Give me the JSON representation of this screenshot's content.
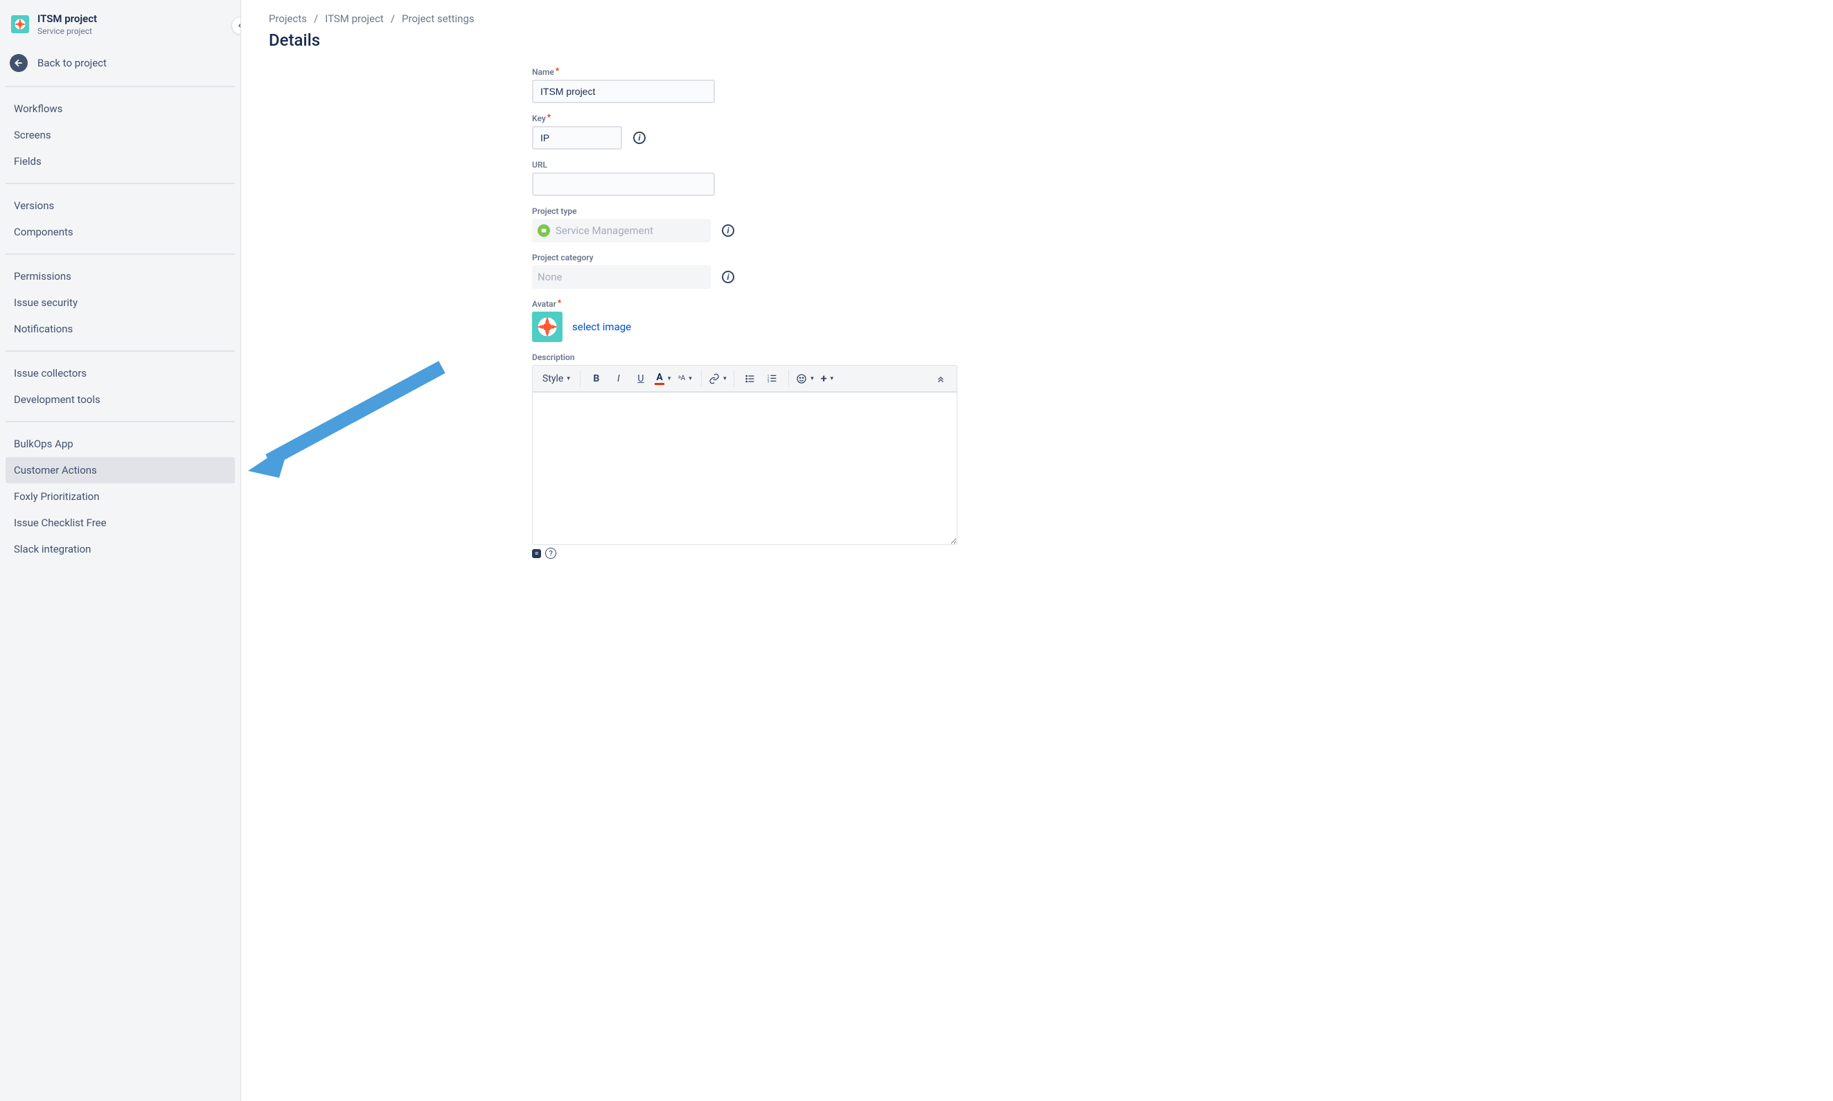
{
  "sidebar": {
    "project_title": "ITSM project",
    "project_subtitle": "Service project",
    "back_label": "Back to project",
    "groups": [
      {
        "items": [
          {
            "label": "Workflows",
            "selected": false
          },
          {
            "label": "Screens",
            "selected": false
          },
          {
            "label": "Fields",
            "selected": false
          }
        ]
      },
      {
        "items": [
          {
            "label": "Versions",
            "selected": false
          },
          {
            "label": "Components",
            "selected": false
          }
        ]
      },
      {
        "items": [
          {
            "label": "Permissions",
            "selected": false
          },
          {
            "label": "Issue security",
            "selected": false
          },
          {
            "label": "Notifications",
            "selected": false
          }
        ]
      },
      {
        "items": [
          {
            "label": "Issue collectors",
            "selected": false
          },
          {
            "label": "Development tools",
            "selected": false
          }
        ]
      },
      {
        "items": [
          {
            "label": "BulkOps App",
            "selected": false
          },
          {
            "label": "Customer Actions",
            "selected": true
          },
          {
            "label": "Foxly Prioritization",
            "selected": false
          },
          {
            "label": "Issue Checklist Free",
            "selected": false
          },
          {
            "label": "Slack integration",
            "selected": false
          }
        ]
      }
    ]
  },
  "breadcrumb": {
    "projects": "Projects",
    "project": "ITSM project",
    "settings": "Project settings"
  },
  "page_title": "Details",
  "form": {
    "name_label": "Name",
    "name_value": "ITSM project",
    "key_label": "Key",
    "key_value": "IP",
    "url_label": "URL",
    "url_value": "",
    "project_type_label": "Project type",
    "project_type_value": "Service Management",
    "project_category_label": "Project category",
    "project_category_value": "None",
    "avatar_label": "Avatar",
    "select_image": "select image",
    "description_label": "Description"
  },
  "editor": {
    "style": "Style"
  }
}
